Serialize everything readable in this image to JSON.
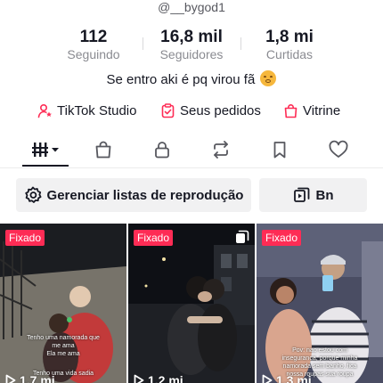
{
  "profile": {
    "handle": "@__bygod1",
    "bio": "Se entro aki é pq virou fã"
  },
  "stats": [
    {
      "value": "112",
      "label": "Seguindo"
    },
    {
      "value": "16,8 mil",
      "label": "Seguidores"
    },
    {
      "value": "1,8 mi",
      "label": "Curtidas"
    }
  ],
  "links": {
    "studio": "TikTok Studio",
    "orders": "Seus pedidos",
    "showcase": "Vitrine"
  },
  "tabs": [
    {
      "icon": "grid-icon",
      "active": true
    },
    {
      "icon": "bag-icon"
    },
    {
      "icon": "lock-icon"
    },
    {
      "icon": "repost-icon"
    },
    {
      "icon": "bookmark-icon"
    },
    {
      "icon": "heart-icon"
    }
  ],
  "actions": {
    "playlists": "Gerenciar listas de reprodução",
    "bn": "Bn"
  },
  "videos": [
    {
      "pinned_label": "Fixado",
      "views": "1,7 mi",
      "caption": [
        "Tenho uma namorada que",
        "me ama",
        "Ela me ama",
        "Tenho uma vida sadia"
      ]
    },
    {
      "pinned_label": "Fixado",
      "views": "1,2 mi",
      "caption": []
    },
    {
      "pinned_label": "Fixado",
      "views": "1,3 mi",
      "caption": [
        "Pov: nao estou com",
        "inseguranca, porque minha",
        "namorada sem banho, fica",
        "nossa roupas sua roupa"
      ]
    }
  ],
  "colors": {
    "accent": "#fe2c55",
    "text": "#161823",
    "muted": "#8a8b91"
  }
}
